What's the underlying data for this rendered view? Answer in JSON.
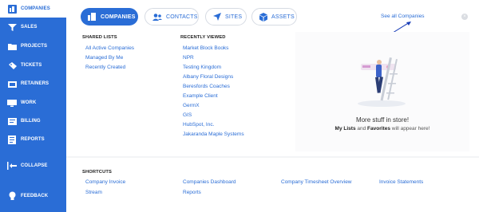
{
  "sidebar": {
    "items": [
      {
        "label": "COMPANIES",
        "icon": "companies-icon"
      },
      {
        "label": "SALES",
        "icon": "funnel-icon"
      },
      {
        "label": "PROJECTS",
        "icon": "folder-icon"
      },
      {
        "label": "TICKETS",
        "icon": "ticket-icon"
      },
      {
        "label": "RETAINERS",
        "icon": "retainer-icon"
      },
      {
        "label": "WORK",
        "icon": "monitor-icon"
      },
      {
        "label": "BILLING",
        "icon": "billing-icon"
      },
      {
        "label": "REPORTS",
        "icon": "report-icon"
      },
      {
        "label": "COLLAPSE",
        "icon": "collapse-icon"
      },
      {
        "label": "FEEDBACK",
        "icon": "lightbulb-icon"
      }
    ]
  },
  "tabs": [
    {
      "label": "COMPANIES",
      "icon": "companies-icon"
    },
    {
      "label": "CONTACTS",
      "icon": "contacts-icon"
    },
    {
      "label": "SITES",
      "icon": "location-arrow-icon"
    },
    {
      "label": "ASSETS",
      "icon": "cube-icon"
    }
  ],
  "see_all": "See all Companies",
  "shared_lists": {
    "heading": "SHARED LISTS",
    "items": [
      "All Active Companies",
      "Managed By Me",
      "Recently Created"
    ]
  },
  "recently_viewed": {
    "heading": "RECENTLY VIEWED",
    "items": [
      "Market Block Books",
      "NPR",
      "Testing Kingdom",
      "Albany Floral Designs",
      "Beresfords Coaches",
      "Example Client",
      "GermX",
      "GIS",
      "HubSpot, Inc.",
      "Jakaranda Maple Systems"
    ]
  },
  "promo": {
    "title": "More stuff in store!",
    "sub_bold": "My Lists",
    "sub_mid": " and ",
    "sub_bold2": "Favorites",
    "sub_end": " will appear here!"
  },
  "shortcuts": {
    "heading": "SHORTCUTS",
    "items": [
      "Company Invoice",
      "Stream",
      "Companies Dashboard",
      "Reports",
      "Company Timesheet Overview",
      "Invoice Statements"
    ]
  },
  "colors": {
    "brand": "#2a6dd6"
  }
}
